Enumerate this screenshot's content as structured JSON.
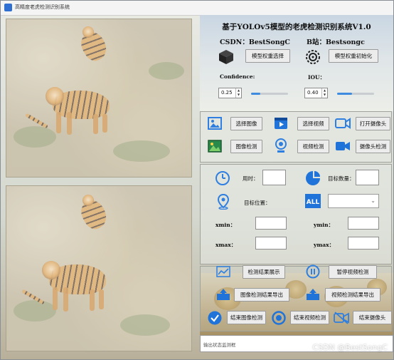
{
  "window": {
    "title": "高精度老虎检测识别系统"
  },
  "header": {
    "title": "基于YOLOv5模型的老虎检测识别系统V1.0",
    "csdn": "CSDN：BestSongC",
    "bilibili": "B站：Bestsongc"
  },
  "model": {
    "select_label": "模型权重选择",
    "init_label": "模型权重初始化",
    "confidence_label": "Confidence:",
    "iou_label": "IOU：",
    "confidence_value": "0.25",
    "iou_value": "0.40",
    "confidence_level": 0.25,
    "iou_level": 0.4
  },
  "actions": {
    "select_image": "选择图像",
    "select_video": "选择视频",
    "open_camera": "打开摄像头",
    "detect_image": "图像检测",
    "detect_video": "视频检测",
    "detect_camera": "摄像头检测"
  },
  "results": {
    "time_label": "用时：",
    "count_label": "目标数量：",
    "position_label": "目标位置：",
    "xmin_label": "xmin：",
    "ymin_label": "ymin：",
    "xmax_label": "xmax：",
    "ymax_label": "ymax：",
    "target_select_value": ""
  },
  "bottom": {
    "show_results": "检测结果展示",
    "pause_video": "暂停视频检测",
    "export_image": "图像检测结果导出",
    "export_video": "视频检测结果导出",
    "end_image": "结束图像检测",
    "end_video": "结束视频检测",
    "end_camera": "结束摄像头"
  },
  "status": {
    "placeholder": "输出状态监测框"
  },
  "watermark": "CSDN @BestSongC",
  "icons": {
    "cube": "cube-icon",
    "gear": "gear-icon",
    "image": "image-icon",
    "video": "video-icon",
    "camera": "camera-icon",
    "timer": "timer-icon",
    "pie": "pie-chart-icon",
    "location": "location-pin-icon",
    "all": "all-icon"
  },
  "colors": {
    "accent": "#2f7fe0",
    "slider_fill": "#3f8be0"
  }
}
